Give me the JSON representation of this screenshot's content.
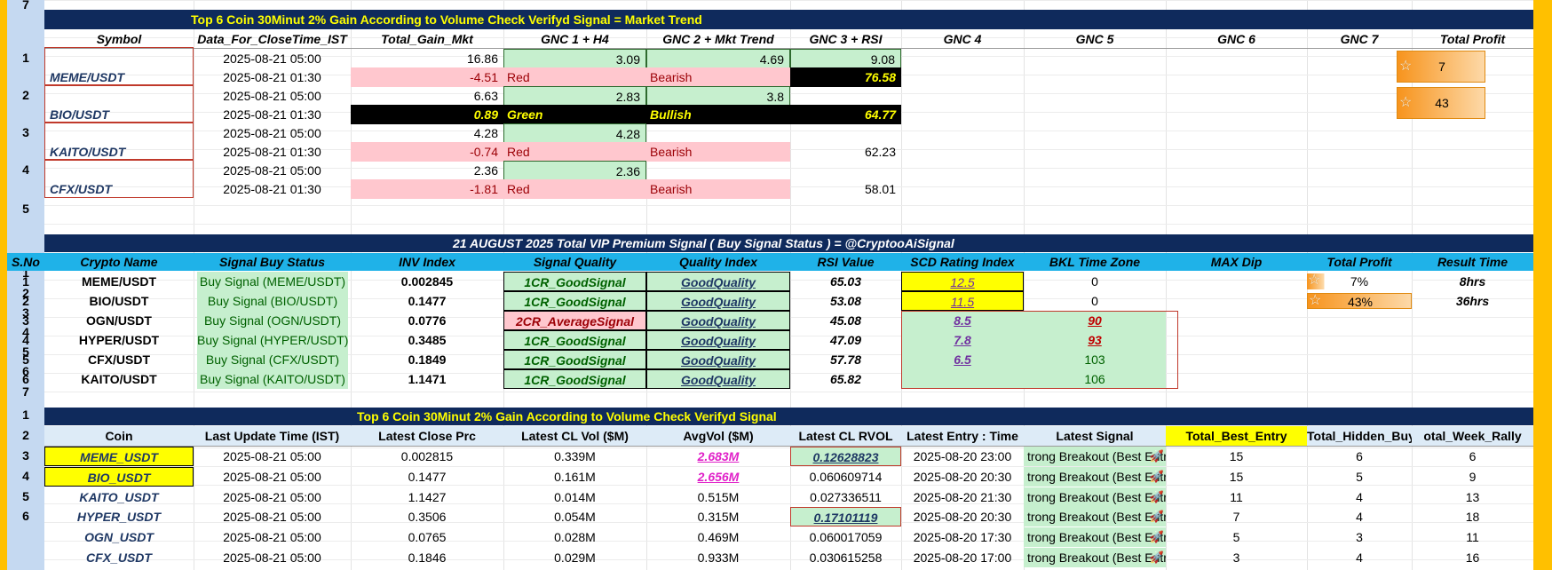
{
  "sheet": {
    "row_numbers": [
      "7",
      "1",
      "2",
      "3",
      "4",
      "5",
      "1",
      "2",
      "3",
      "4",
      "5",
      "6",
      "7",
      "1",
      "2",
      "3",
      "4",
      "5",
      "6"
    ]
  },
  "top_table": {
    "title": "Top 6 Coin  30Minut 2% Gain  According to Volume  Check Verifyd Signal  =  Market Trend",
    "headers": [
      "Symbol",
      "Data_For_CloseTime_IST",
      "Total_Gain_Mkt",
      "GNC 1 + H4",
      "GNC 2 + Mkt Trend",
      "GNC 3 + RSI",
      "GNC 4",
      "GNC 5",
      "GNC 6",
      "GNC 7",
      "Total Profit"
    ],
    "rows": [
      {
        "symbol": "MEME/USDT",
        "t1": "2025-08-21 05:00",
        "g1": "16.86",
        "h4_1": "3.09",
        "mkt_1": "4.69",
        "rsi_1": "9.08",
        "t2": "2025-08-21 01:30",
        "g2": "-4.51",
        "h4_2": "Red",
        "mkt_2": "Bearish",
        "rsi_2": "76.58",
        "profit": "7"
      },
      {
        "symbol": "BIO/USDT",
        "t1": "2025-08-21 05:00",
        "g1": "6.63",
        "h4_1": "2.83",
        "mkt_1": "3.8",
        "rsi_1": "",
        "t2": "2025-08-21 01:30",
        "g2": "0.89",
        "h4_2": "Green",
        "mkt_2": "Bullish",
        "rsi_2": "64.77",
        "profit": "43"
      },
      {
        "symbol": "KAITO/USDT",
        "t1": "2025-08-21 05:00",
        "g1": "4.28",
        "h4_1": "4.28",
        "mkt_1": "",
        "rsi_1": "",
        "t2": "2025-08-21 01:30",
        "g2": "-0.74",
        "h4_2": "Red",
        "mkt_2": "Bearish",
        "rsi_2": "62.23",
        "profit": ""
      },
      {
        "symbol": "CFX/USDT",
        "t1": "2025-08-21 05:00",
        "g1": "2.36",
        "h4_1": "2.36",
        "mkt_1": "",
        "rsi_1": "",
        "t2": "2025-08-21 01:30",
        "g2": "-1.81",
        "h4_2": "Red",
        "mkt_2": "Bearish",
        "rsi_2": "58.01",
        "profit": ""
      }
    ]
  },
  "vip_table": {
    "title": "21 AUGUST  2025 Total VIP Premium Signal  ( Buy Signal Status )     =    @CryptooAiSignal",
    "headers": [
      "S.No",
      "Crypto Name",
      "Signal Buy Status",
      "INV  Index",
      "Signal Quality",
      "Quality Index",
      "RSI Value",
      "SCD  Rating Index",
      "BKL Time Zone",
      "MAX Dip",
      "Total Profit",
      "Result Time"
    ],
    "rows": [
      {
        "sno": "1",
        "name": "MEME/USDT",
        "status": "Buy Signal (MEME/USDT)",
        "inv": "0.002845",
        "quality": "1CR_GoodSignal",
        "qindex": "GoodQuality",
        "rsi": "65.03",
        "scd": "12.5",
        "bkl": "0",
        "profit": "7%",
        "result": "8hrs"
      },
      {
        "sno": "2",
        "name": "BIO/USDT",
        "status": "Buy Signal (BIO/USDT)",
        "inv": "0.1477",
        "quality": "1CR_GoodSignal",
        "qindex": "GoodQuality",
        "rsi": "53.08",
        "scd": "11.5",
        "bkl": "0",
        "profit": "43%",
        "result": "36hrs"
      },
      {
        "sno": "3",
        "name": "OGN/USDT",
        "status": "Buy Signal (OGN/USDT)",
        "inv": "0.0776",
        "quality": "2CR_AverageSignal",
        "qindex": "GoodQuality",
        "rsi": "45.08",
        "scd": "8.5",
        "bkl": "90",
        "profit": "",
        "result": ""
      },
      {
        "sno": "4",
        "name": "HYPER/USDT",
        "status": "Buy Signal (HYPER/USDT)",
        "inv": "0.3485",
        "quality": "1CR_GoodSignal",
        "qindex": "GoodQuality",
        "rsi": "47.09",
        "scd": "7.8",
        "bkl": "93",
        "profit": "",
        "result": ""
      },
      {
        "sno": "5",
        "name": "CFX/USDT",
        "status": "Buy Signal (CFX/USDT)",
        "inv": "0.1849",
        "quality": "1CR_GoodSignal",
        "qindex": "GoodQuality",
        "rsi": "57.78",
        "scd": "6.5",
        "bkl": "103",
        "profit": "",
        "result": ""
      },
      {
        "sno": "6",
        "name": "KAITO/USDT",
        "status": "Buy Signal (KAITO/USDT)",
        "inv": "1.1471",
        "quality": "1CR_GoodSignal",
        "qindex": "GoodQuality",
        "rsi": "65.82",
        "scd": "",
        "bkl": "106",
        "profit": "",
        "result": ""
      }
    ]
  },
  "bottom_table": {
    "title": "Top 6 Coin  30Minut 2% Gain  According to Volume  Check Verifyd Signal",
    "headers": [
      "Coin",
      "Last Update Time (IST)",
      "Latest Close  Prc",
      "Latest CL Vol ($M)",
      "AvgVol ($M)",
      "Latest CL  RVOL",
      "Latest Entry :  Time",
      "Latest Signal",
      "Total_Best_Entry",
      "Total_Hidden_Buy",
      "otal_Week_Rally"
    ],
    "rows": [
      {
        "coin": "MEME_USDT",
        "time": "2025-08-21 05:00",
        "close": "0.002815",
        "vol": "0.339M",
        "avg": "2.683M",
        "rvol": "0.12628823",
        "entry": "2025-08-20 23:00",
        "signal": "trong Breakout (Best Entry",
        "best": "15",
        "hidden": "6",
        "week": "6"
      },
      {
        "coin": "BIO_USDT",
        "time": "2025-08-21 05:00",
        "close": "0.1477",
        "vol": "0.161M",
        "avg": "2.656M",
        "rvol": "0.060609714",
        "entry": "2025-08-20 20:30",
        "signal": "trong Breakout (Best Entry",
        "best": "15",
        "hidden": "5",
        "week": "9"
      },
      {
        "coin": "KAITO_USDT",
        "time": "2025-08-21 05:00",
        "close": "1.1427",
        "vol": "0.014M",
        "avg": "0.515M",
        "rvol": "0.027336511",
        "entry": "2025-08-20 21:30",
        "signal": "trong Breakout (Best Entry",
        "best": "11",
        "hidden": "4",
        "week": "13"
      },
      {
        "coin": "HYPER_USDT",
        "time": "2025-08-21 05:00",
        "close": "0.3506",
        "vol": "0.054M",
        "avg": "0.315M",
        "rvol": "0.17101119",
        "entry": "2025-08-20 20:30",
        "signal": "trong Breakout (Best Entry",
        "best": "7",
        "hidden": "4",
        "week": "18"
      },
      {
        "coin": "OGN_USDT",
        "time": "2025-08-21 05:00",
        "close": "0.0765",
        "vol": "0.028M",
        "avg": "0.469M",
        "rvol": "0.060017059",
        "entry": "2025-08-20 17:30",
        "signal": "trong Breakout (Best Entry",
        "best": "5",
        "hidden": "3",
        "week": "11"
      },
      {
        "coin": "CFX_USDT",
        "time": "2025-08-21 05:00",
        "close": "0.1846",
        "vol": "0.029M",
        "avg": "0.933M",
        "rvol": "0.030615258",
        "entry": "2025-08-20 17:00",
        "signal": "trong Breakout (Best Entry",
        "best": "3",
        "hidden": "4",
        "week": "16"
      }
    ]
  },
  "icons": {
    "star": "star-icon",
    "rocket": "rocket-icon"
  },
  "colors": {
    "navy": "#0F2A5C",
    "header_text": "#FFFF00",
    "cyan": "#1FB2E8",
    "green_fill": "#C6EFCE",
    "red_fill": "#FFC7CE",
    "green_text": "#006100",
    "red_text": "#9C0006",
    "dark_blue_text": "#1F3864",
    "magenta": "#E020C8",
    "orange": "#F7941D"
  }
}
